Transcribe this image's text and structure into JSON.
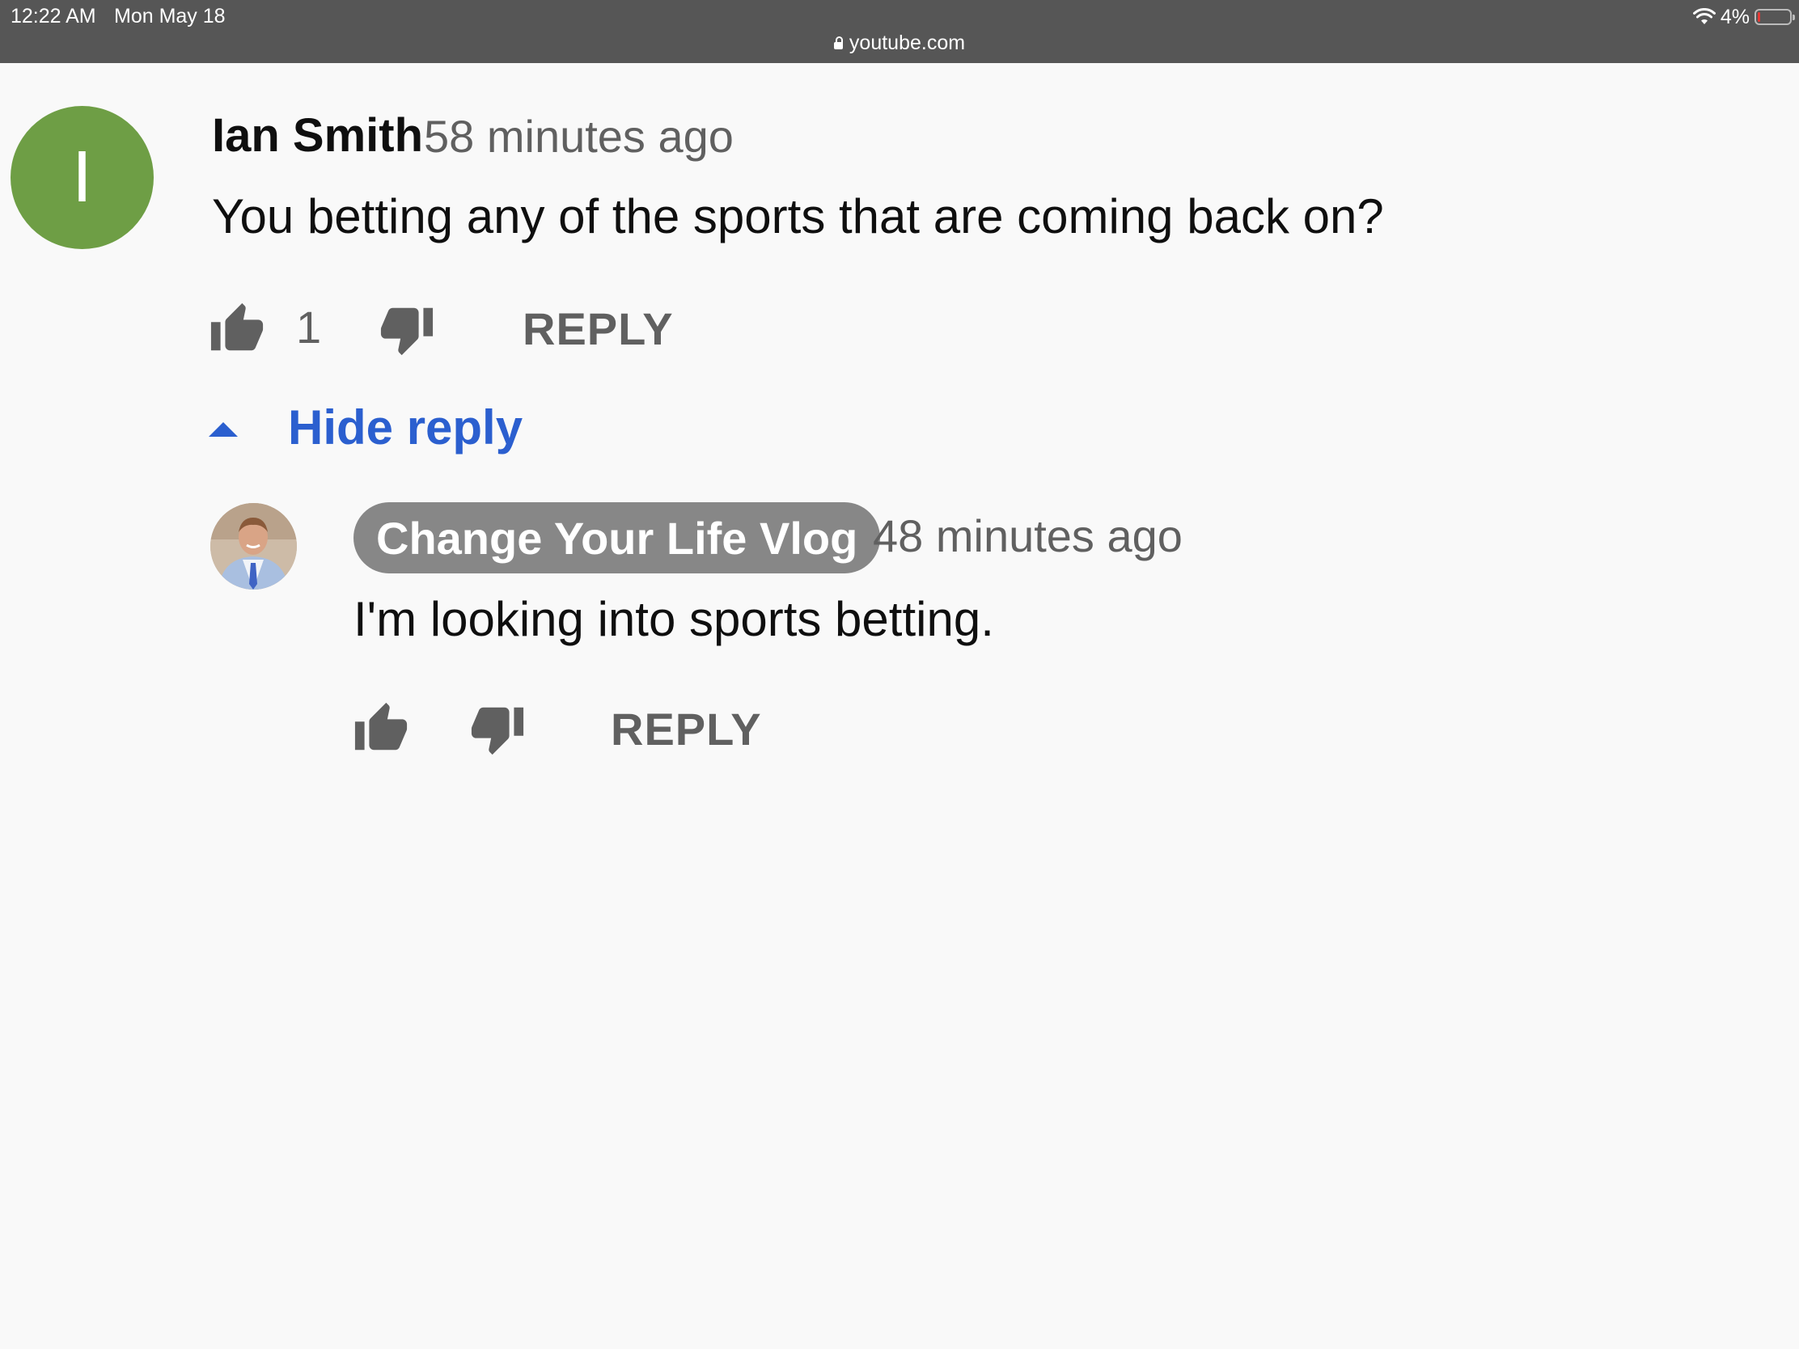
{
  "status_bar": {
    "time": "12:22 AM",
    "date": "Mon May 18",
    "url": "youtube.com",
    "battery": "4%",
    "battery_level_percent": 4
  },
  "comment": {
    "avatar_letter": "I",
    "avatar_color": "#6e9e45",
    "author": "Ian Smith",
    "timestamp": "58 minutes ago",
    "text": "You betting any of the sports that are coming back on?",
    "like_count": "1",
    "reply_label": "REPLY",
    "hide_reply_label": "Hide reply"
  },
  "reply": {
    "author": "Change Your Life Vlog",
    "timestamp": "48 minutes ago",
    "text": "I'm looking into sports betting.",
    "reply_label": "REPLY"
  },
  "colors": {
    "link": "#2b5fcf",
    "secondary_text": "#606060",
    "badge": "#878787"
  }
}
